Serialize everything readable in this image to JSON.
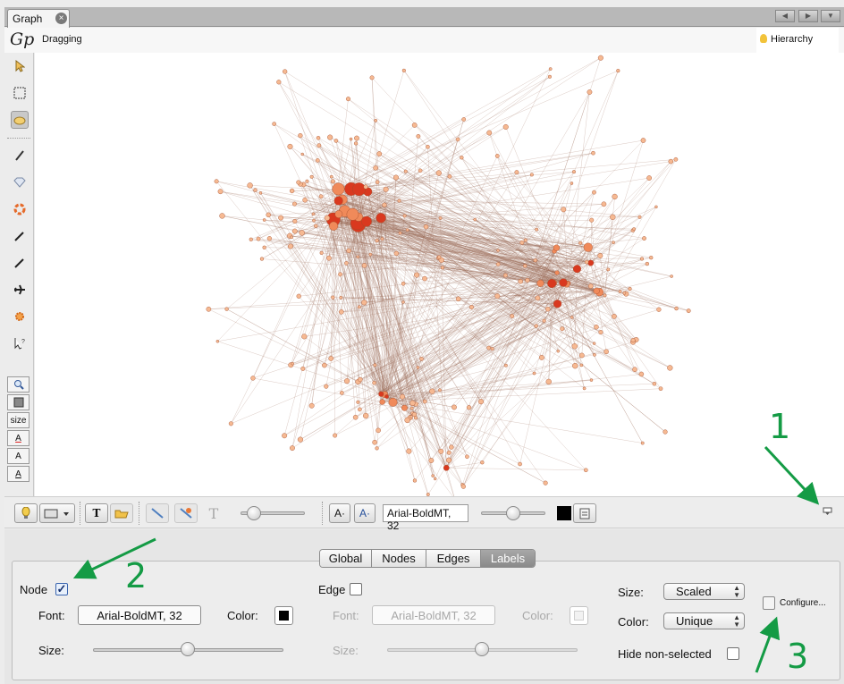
{
  "tab": {
    "label": "Graph"
  },
  "topbar": {
    "mode": "Dragging",
    "hierarchy": "Hierarchy"
  },
  "left_toolbar": {
    "size_label": "size"
  },
  "preview_bar": {
    "font_value": "Arial-BoldMT, 32"
  },
  "tabs": [
    "Global",
    "Nodes",
    "Edges",
    "Labels"
  ],
  "active_tab": "Labels",
  "labels_panel": {
    "node": {
      "label": "Node",
      "checked": true,
      "font_label": "Font:",
      "font_value": "Arial-BoldMT, 32",
      "color_label": "Color:",
      "size_label": "Size:",
      "size_slider": 0.5
    },
    "edge": {
      "label": "Edge",
      "checked": false,
      "font_label": "Font:",
      "font_value": "Arial-BoldMT, 32",
      "color_label": "Color:",
      "size_label": "Size:",
      "size_slider": 0.5
    },
    "size": {
      "label": "Size:",
      "value": "Scaled"
    },
    "color": {
      "label": "Color:",
      "value": "Unique"
    },
    "hide_non_selected": {
      "label": "Hide non-selected",
      "checked": false
    },
    "configure": "Configure..."
  },
  "annotations": [
    "1",
    "2",
    "3"
  ],
  "colors": {
    "annotation": "#149b45",
    "node_dark": "#d9391f",
    "node_light": "#f6b992",
    "edge": "#9b6a56"
  }
}
